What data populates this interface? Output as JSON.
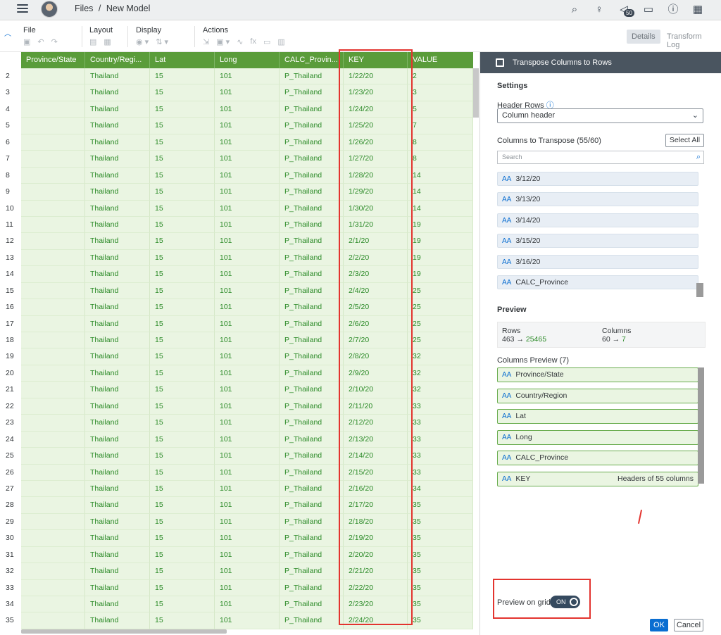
{
  "shell": {
    "breadcrumb": [
      "Files",
      "/",
      "New Model"
    ],
    "notification_count": "50",
    "icons": [
      "search-icon",
      "lightbulb-icon",
      "megaphone-icon",
      "chat-icon",
      "help-icon",
      "grid-icon"
    ]
  },
  "toolbar": {
    "groups": [
      "File",
      "Layout",
      "Display",
      "Actions"
    ],
    "details_tab": "Details",
    "transform_log_tab": "Transform Log"
  },
  "grid": {
    "columns": [
      "Province/State",
      "Country/Regi...",
      "Lat",
      "Long",
      "CALC_Provin...",
      "KEY",
      "VALUE"
    ],
    "rows": [
      {
        "n": "2",
        "country": "Thailand",
        "lat": "15",
        "long": "101",
        "calc": "P_Thailand",
        "key": "1/22/20",
        "value": "2"
      },
      {
        "n": "3",
        "country": "Thailand",
        "lat": "15",
        "long": "101",
        "calc": "P_Thailand",
        "key": "1/23/20",
        "value": "3"
      },
      {
        "n": "4",
        "country": "Thailand",
        "lat": "15",
        "long": "101",
        "calc": "P_Thailand",
        "key": "1/24/20",
        "value": "5"
      },
      {
        "n": "5",
        "country": "Thailand",
        "lat": "15",
        "long": "101",
        "calc": "P_Thailand",
        "key": "1/25/20",
        "value": "7"
      },
      {
        "n": "6",
        "country": "Thailand",
        "lat": "15",
        "long": "101",
        "calc": "P_Thailand",
        "key": "1/26/20",
        "value": "8"
      },
      {
        "n": "7",
        "country": "Thailand",
        "lat": "15",
        "long": "101",
        "calc": "P_Thailand",
        "key": "1/27/20",
        "value": "8"
      },
      {
        "n": "8",
        "country": "Thailand",
        "lat": "15",
        "long": "101",
        "calc": "P_Thailand",
        "key": "1/28/20",
        "value": "14"
      },
      {
        "n": "9",
        "country": "Thailand",
        "lat": "15",
        "long": "101",
        "calc": "P_Thailand",
        "key": "1/29/20",
        "value": "14"
      },
      {
        "n": "10",
        "country": "Thailand",
        "lat": "15",
        "long": "101",
        "calc": "P_Thailand",
        "key": "1/30/20",
        "value": "14"
      },
      {
        "n": "11",
        "country": "Thailand",
        "lat": "15",
        "long": "101",
        "calc": "P_Thailand",
        "key": "1/31/20",
        "value": "19"
      },
      {
        "n": "12",
        "country": "Thailand",
        "lat": "15",
        "long": "101",
        "calc": "P_Thailand",
        "key": "2/1/20",
        "value": "19"
      },
      {
        "n": "13",
        "country": "Thailand",
        "lat": "15",
        "long": "101",
        "calc": "P_Thailand",
        "key": "2/2/20",
        "value": "19"
      },
      {
        "n": "14",
        "country": "Thailand",
        "lat": "15",
        "long": "101",
        "calc": "P_Thailand",
        "key": "2/3/20",
        "value": "19"
      },
      {
        "n": "15",
        "country": "Thailand",
        "lat": "15",
        "long": "101",
        "calc": "P_Thailand",
        "key": "2/4/20",
        "value": "25"
      },
      {
        "n": "16",
        "country": "Thailand",
        "lat": "15",
        "long": "101",
        "calc": "P_Thailand",
        "key": "2/5/20",
        "value": "25"
      },
      {
        "n": "17",
        "country": "Thailand",
        "lat": "15",
        "long": "101",
        "calc": "P_Thailand",
        "key": "2/6/20",
        "value": "25"
      },
      {
        "n": "18",
        "country": "Thailand",
        "lat": "15",
        "long": "101",
        "calc": "P_Thailand",
        "key": "2/7/20",
        "value": "25"
      },
      {
        "n": "19",
        "country": "Thailand",
        "lat": "15",
        "long": "101",
        "calc": "P_Thailand",
        "key": "2/8/20",
        "value": "32"
      },
      {
        "n": "20",
        "country": "Thailand",
        "lat": "15",
        "long": "101",
        "calc": "P_Thailand",
        "key": "2/9/20",
        "value": "32"
      },
      {
        "n": "21",
        "country": "Thailand",
        "lat": "15",
        "long": "101",
        "calc": "P_Thailand",
        "key": "2/10/20",
        "value": "32"
      },
      {
        "n": "22",
        "country": "Thailand",
        "lat": "15",
        "long": "101",
        "calc": "P_Thailand",
        "key": "2/11/20",
        "value": "33"
      },
      {
        "n": "23",
        "country": "Thailand",
        "lat": "15",
        "long": "101",
        "calc": "P_Thailand",
        "key": "2/12/20",
        "value": "33"
      },
      {
        "n": "24",
        "country": "Thailand",
        "lat": "15",
        "long": "101",
        "calc": "P_Thailand",
        "key": "2/13/20",
        "value": "33"
      },
      {
        "n": "25",
        "country": "Thailand",
        "lat": "15",
        "long": "101",
        "calc": "P_Thailand",
        "key": "2/14/20",
        "value": "33"
      },
      {
        "n": "26",
        "country": "Thailand",
        "lat": "15",
        "long": "101",
        "calc": "P_Thailand",
        "key": "2/15/20",
        "value": "33"
      },
      {
        "n": "27",
        "country": "Thailand",
        "lat": "15",
        "long": "101",
        "calc": "P_Thailand",
        "key": "2/16/20",
        "value": "34"
      },
      {
        "n": "28",
        "country": "Thailand",
        "lat": "15",
        "long": "101",
        "calc": "P_Thailand",
        "key": "2/17/20",
        "value": "35"
      },
      {
        "n": "29",
        "country": "Thailand",
        "lat": "15",
        "long": "101",
        "calc": "P_Thailand",
        "key": "2/18/20",
        "value": "35"
      },
      {
        "n": "30",
        "country": "Thailand",
        "lat": "15",
        "long": "101",
        "calc": "P_Thailand",
        "key": "2/19/20",
        "value": "35"
      },
      {
        "n": "31",
        "country": "Thailand",
        "lat": "15",
        "long": "101",
        "calc": "P_Thailand",
        "key": "2/20/20",
        "value": "35"
      },
      {
        "n": "32",
        "country": "Thailand",
        "lat": "15",
        "long": "101",
        "calc": "P_Thailand",
        "key": "2/21/20",
        "value": "35"
      },
      {
        "n": "33",
        "country": "Thailand",
        "lat": "15",
        "long": "101",
        "calc": "P_Thailand",
        "key": "2/22/20",
        "value": "35"
      },
      {
        "n": "34",
        "country": "Thailand",
        "lat": "15",
        "long": "101",
        "calc": "P_Thailand",
        "key": "2/23/20",
        "value": "35"
      },
      {
        "n": "35",
        "country": "Thailand",
        "lat": "15",
        "long": "101",
        "calc": "P_Thailand",
        "key": "2/24/20",
        "value": "35"
      }
    ]
  },
  "panel": {
    "title": "Transpose Columns to Rows",
    "settings_label": "Settings",
    "header_rows_label": "Header Rows",
    "header_rows_value": "Column header",
    "columns_to_transpose_label": "Columns to Transpose (55/60)",
    "select_all": "Select All",
    "search_placeholder": "Search",
    "transpose_items": [
      "3/12/20",
      "3/13/20",
      "3/14/20",
      "3/15/20",
      "3/16/20",
      "CALC_Province"
    ],
    "preview_label": "Preview",
    "rows_label": "Rows",
    "rows_from": "463",
    "rows_to": "25465",
    "columns_label": "Columns",
    "columns_from": "60",
    "columns_to": "7",
    "columns_preview_label": "Columns Preview (7)",
    "preview_items": [
      {
        "name": "Province/State",
        "note": ""
      },
      {
        "name": "Country/Region",
        "note": ""
      },
      {
        "name": "Lat",
        "note": ""
      },
      {
        "name": "Long",
        "note": ""
      },
      {
        "name": "CALC_Province",
        "note": ""
      },
      {
        "name": "KEY",
        "note": "Headers of 55 columns"
      }
    ],
    "preview_on_grid": "Preview on grid",
    "toggle_state": "ON",
    "ok": "OK",
    "cancel": "Cancel"
  },
  "colors": {
    "header_green": "#5a9c3a",
    "cell_green": "#eaf5e2",
    "text_green": "#2b8a27",
    "highlight_red": "#e3342f",
    "accent_blue": "#0a6ed1"
  }
}
